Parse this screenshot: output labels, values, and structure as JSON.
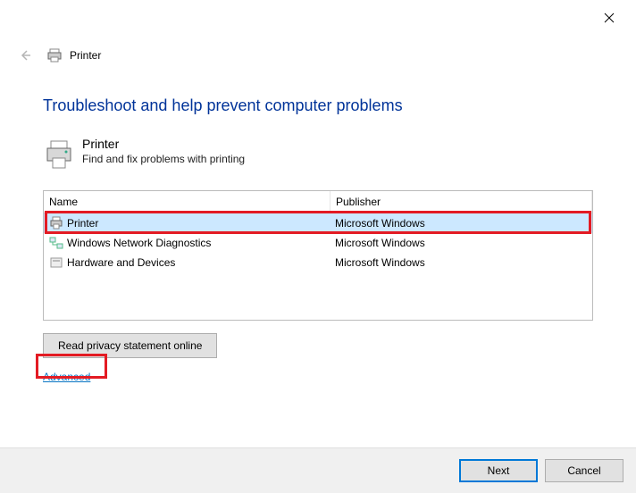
{
  "window": {
    "title": "Printer"
  },
  "main": {
    "heading": "Troubleshoot and help prevent computer problems",
    "section_title": "Printer",
    "section_sub": "Find and fix problems with printing"
  },
  "list": {
    "headers": {
      "name": "Name",
      "publisher": "Publisher"
    },
    "rows": [
      {
        "name": "Printer",
        "publisher": "Microsoft Windows",
        "selected": true,
        "icon": "printer"
      },
      {
        "name": "Windows Network Diagnostics",
        "publisher": "Microsoft Windows",
        "selected": false,
        "icon": "network"
      },
      {
        "name": "Hardware and Devices",
        "publisher": "Microsoft Windows",
        "selected": false,
        "icon": "device"
      }
    ]
  },
  "actions": {
    "privacy": "Read privacy statement online",
    "advanced": "Advanced"
  },
  "footer": {
    "next": "Next",
    "cancel": "Cancel"
  },
  "highlights": {
    "row_index": 0,
    "advanced_link": true
  }
}
